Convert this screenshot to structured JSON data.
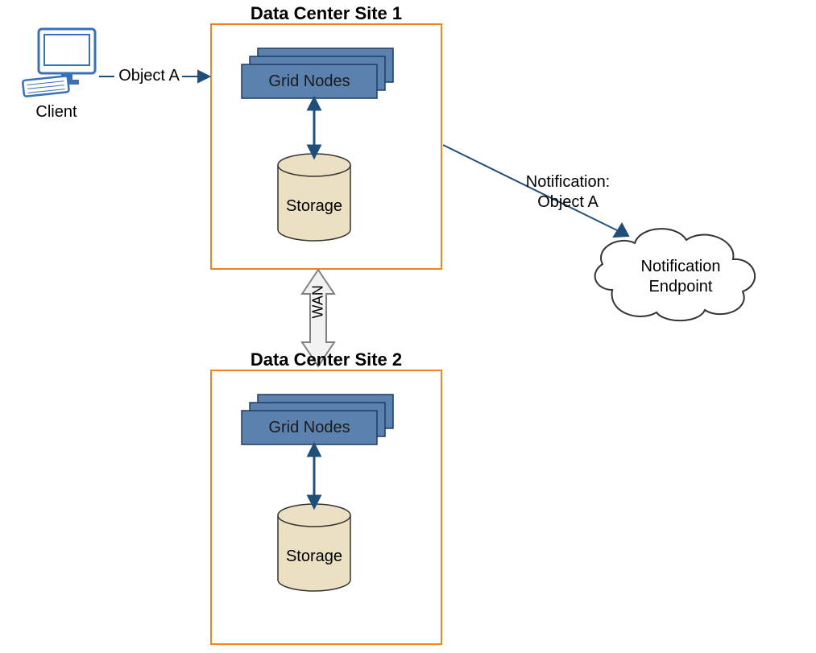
{
  "client": {
    "label": "Client"
  },
  "objectA": {
    "label": "Object A"
  },
  "site1": {
    "title": "Data Center Site 1",
    "gridNodes": "Grid Nodes",
    "storage": "Storage"
  },
  "site2": {
    "title": "Data Center Site 2",
    "gridNodes": "Grid Nodes",
    "storage": "Storage"
  },
  "wan": {
    "label": "WAN"
  },
  "notification": {
    "line1": "Notification:",
    "line2": "Object A"
  },
  "endpoint": {
    "line1": "Notification",
    "line2": "Endpoint"
  },
  "colors": {
    "siteBox": "#f58220",
    "nodeFill": "#5b82ae",
    "nodeStroke": "#1f3b63",
    "storageFill": "#ece0c3",
    "storageStroke": "#333333",
    "clientBlue": "#3970b8",
    "arrowBlue": "#1f4e79"
  }
}
